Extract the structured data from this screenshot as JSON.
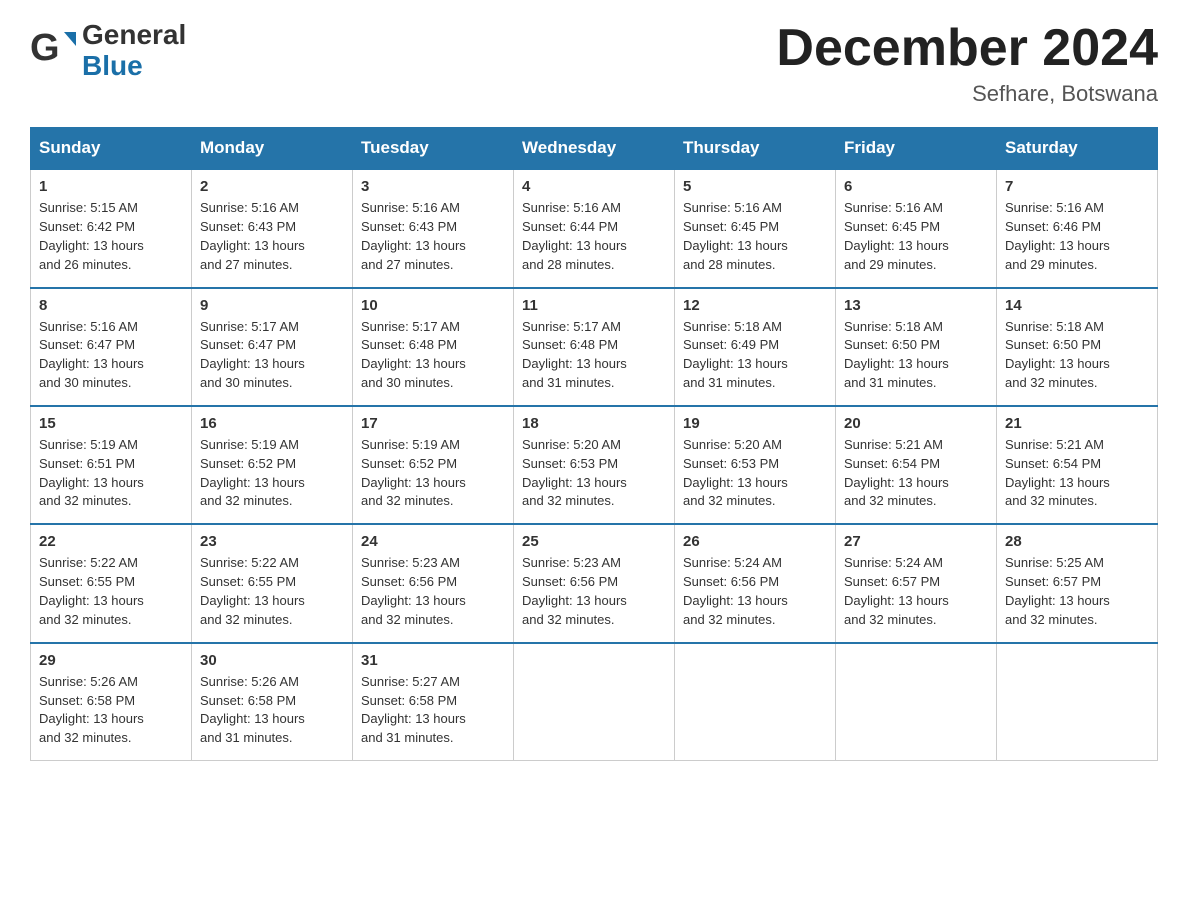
{
  "header": {
    "logo_general": "General",
    "logo_blue": "Blue",
    "month_title": "December 2024",
    "location": "Sefhare, Botswana"
  },
  "days_of_week": [
    "Sunday",
    "Monday",
    "Tuesday",
    "Wednesday",
    "Thursday",
    "Friday",
    "Saturday"
  ],
  "weeks": [
    [
      {
        "day": "1",
        "sunrise": "5:15 AM",
        "sunset": "6:42 PM",
        "daylight_hours": "13",
        "daylight_minutes": "26"
      },
      {
        "day": "2",
        "sunrise": "5:16 AM",
        "sunset": "6:43 PM",
        "daylight_hours": "13",
        "daylight_minutes": "27"
      },
      {
        "day": "3",
        "sunrise": "5:16 AM",
        "sunset": "6:43 PM",
        "daylight_hours": "13",
        "daylight_minutes": "27"
      },
      {
        "day": "4",
        "sunrise": "5:16 AM",
        "sunset": "6:44 PM",
        "daylight_hours": "13",
        "daylight_minutes": "28"
      },
      {
        "day": "5",
        "sunrise": "5:16 AM",
        "sunset": "6:45 PM",
        "daylight_hours": "13",
        "daylight_minutes": "28"
      },
      {
        "day": "6",
        "sunrise": "5:16 AM",
        "sunset": "6:45 PM",
        "daylight_hours": "13",
        "daylight_minutes": "29"
      },
      {
        "day": "7",
        "sunrise": "5:16 AM",
        "sunset": "6:46 PM",
        "daylight_hours": "13",
        "daylight_minutes": "29"
      }
    ],
    [
      {
        "day": "8",
        "sunrise": "5:16 AM",
        "sunset": "6:47 PM",
        "daylight_hours": "13",
        "daylight_minutes": "30"
      },
      {
        "day": "9",
        "sunrise": "5:17 AM",
        "sunset": "6:47 PM",
        "daylight_hours": "13",
        "daylight_minutes": "30"
      },
      {
        "day": "10",
        "sunrise": "5:17 AM",
        "sunset": "6:48 PM",
        "daylight_hours": "13",
        "daylight_minutes": "30"
      },
      {
        "day": "11",
        "sunrise": "5:17 AM",
        "sunset": "6:48 PM",
        "daylight_hours": "13",
        "daylight_minutes": "31"
      },
      {
        "day": "12",
        "sunrise": "5:18 AM",
        "sunset": "6:49 PM",
        "daylight_hours": "13",
        "daylight_minutes": "31"
      },
      {
        "day": "13",
        "sunrise": "5:18 AM",
        "sunset": "6:50 PM",
        "daylight_hours": "13",
        "daylight_minutes": "31"
      },
      {
        "day": "14",
        "sunrise": "5:18 AM",
        "sunset": "6:50 PM",
        "daylight_hours": "13",
        "daylight_minutes": "32"
      }
    ],
    [
      {
        "day": "15",
        "sunrise": "5:19 AM",
        "sunset": "6:51 PM",
        "daylight_hours": "13",
        "daylight_minutes": "32"
      },
      {
        "day": "16",
        "sunrise": "5:19 AM",
        "sunset": "6:52 PM",
        "daylight_hours": "13",
        "daylight_minutes": "32"
      },
      {
        "day": "17",
        "sunrise": "5:19 AM",
        "sunset": "6:52 PM",
        "daylight_hours": "13",
        "daylight_minutes": "32"
      },
      {
        "day": "18",
        "sunrise": "5:20 AM",
        "sunset": "6:53 PM",
        "daylight_hours": "13",
        "daylight_minutes": "32"
      },
      {
        "day": "19",
        "sunrise": "5:20 AM",
        "sunset": "6:53 PM",
        "daylight_hours": "13",
        "daylight_minutes": "32"
      },
      {
        "day": "20",
        "sunrise": "5:21 AM",
        "sunset": "6:54 PM",
        "daylight_hours": "13",
        "daylight_minutes": "32"
      },
      {
        "day": "21",
        "sunrise": "5:21 AM",
        "sunset": "6:54 PM",
        "daylight_hours": "13",
        "daylight_minutes": "32"
      }
    ],
    [
      {
        "day": "22",
        "sunrise": "5:22 AM",
        "sunset": "6:55 PM",
        "daylight_hours": "13",
        "daylight_minutes": "32"
      },
      {
        "day": "23",
        "sunrise": "5:22 AM",
        "sunset": "6:55 PM",
        "daylight_hours": "13",
        "daylight_minutes": "32"
      },
      {
        "day": "24",
        "sunrise": "5:23 AM",
        "sunset": "6:56 PM",
        "daylight_hours": "13",
        "daylight_minutes": "32"
      },
      {
        "day": "25",
        "sunrise": "5:23 AM",
        "sunset": "6:56 PM",
        "daylight_hours": "13",
        "daylight_minutes": "32"
      },
      {
        "day": "26",
        "sunrise": "5:24 AM",
        "sunset": "6:56 PM",
        "daylight_hours": "13",
        "daylight_minutes": "32"
      },
      {
        "day": "27",
        "sunrise": "5:24 AM",
        "sunset": "6:57 PM",
        "daylight_hours": "13",
        "daylight_minutes": "32"
      },
      {
        "day": "28",
        "sunrise": "5:25 AM",
        "sunset": "6:57 PM",
        "daylight_hours": "13",
        "daylight_minutes": "32"
      }
    ],
    [
      {
        "day": "29",
        "sunrise": "5:26 AM",
        "sunset": "6:58 PM",
        "daylight_hours": "13",
        "daylight_minutes": "32"
      },
      {
        "day": "30",
        "sunrise": "5:26 AM",
        "sunset": "6:58 PM",
        "daylight_hours": "13",
        "daylight_minutes": "31"
      },
      {
        "day": "31",
        "sunrise": "5:27 AM",
        "sunset": "6:58 PM",
        "daylight_hours": "13",
        "daylight_minutes": "31"
      },
      null,
      null,
      null,
      null
    ]
  ],
  "labels": {
    "sunrise": "Sunrise:",
    "sunset": "Sunset:",
    "daylight": "Daylight: 13 hours"
  }
}
